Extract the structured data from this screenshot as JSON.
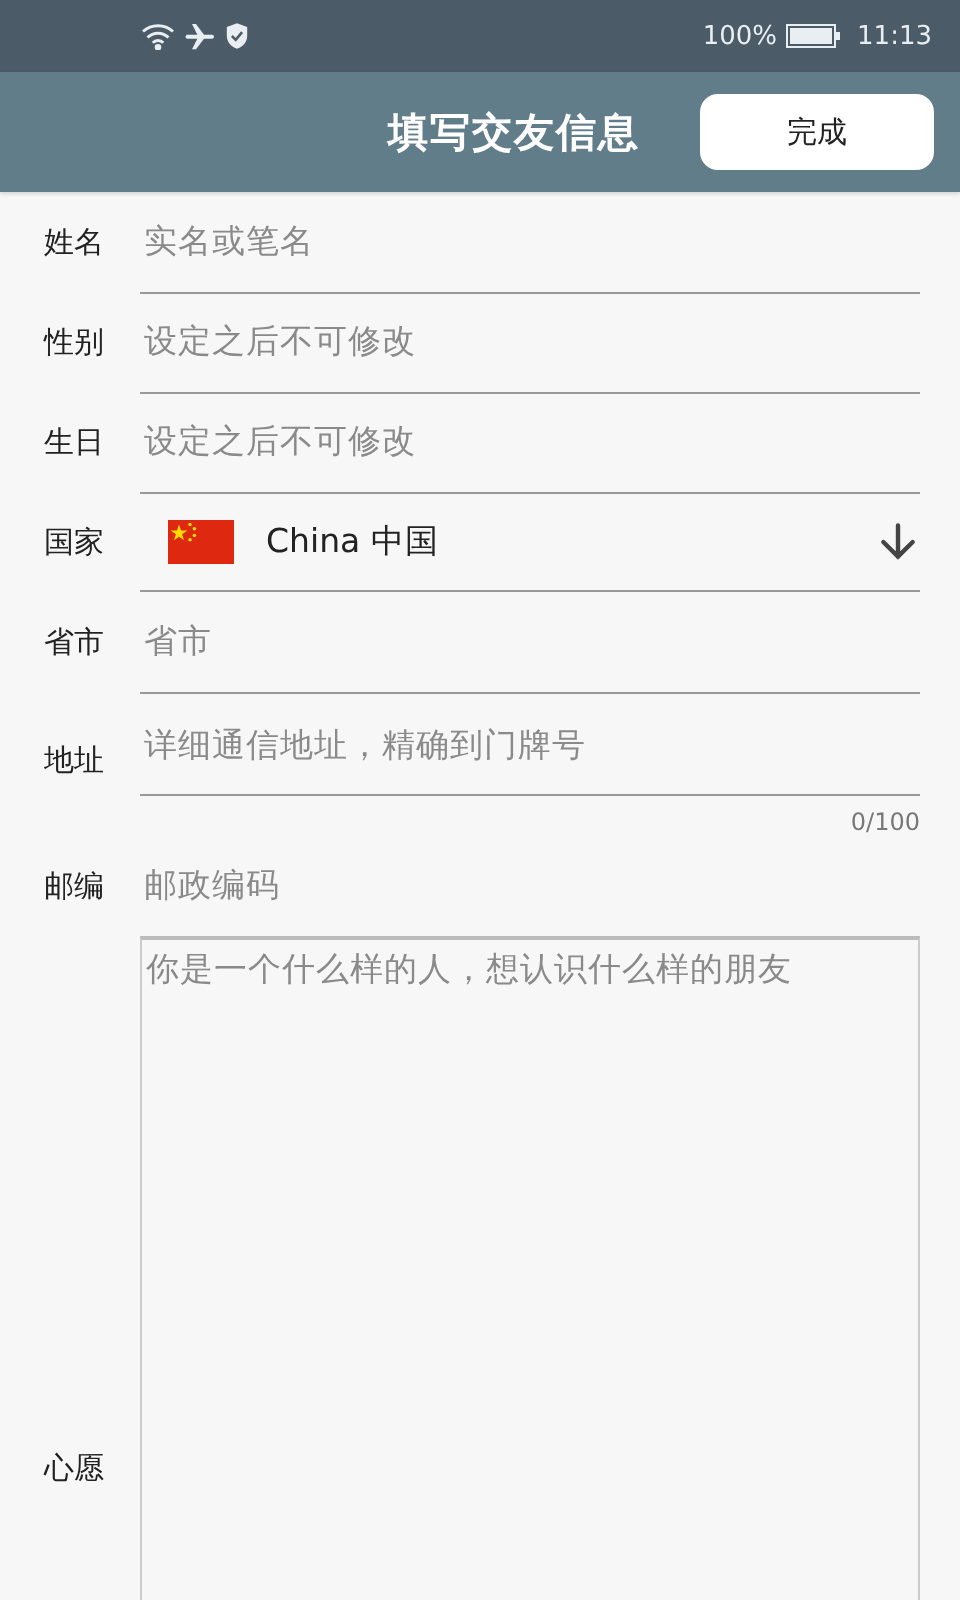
{
  "status_bar": {
    "battery_text": "100%",
    "time": "11:13"
  },
  "header": {
    "title": "填写交友信息",
    "done_button": "完成"
  },
  "fields": [
    {
      "kind": "text",
      "label": "姓名",
      "placeholder": "实名或笔名"
    },
    {
      "kind": "text",
      "label": "性别",
      "placeholder": "设定之后不可修改"
    },
    {
      "kind": "text",
      "label": "生日",
      "placeholder": "设定之后不可修改"
    },
    {
      "kind": "country",
      "label": "国家",
      "value": "China 中国"
    },
    {
      "kind": "text",
      "label": "省市",
      "placeholder": "省市"
    },
    {
      "kind": "text",
      "label": "地址",
      "placeholder": "详细通信地址，精确到门牌号",
      "counter": "0/100"
    },
    {
      "kind": "text",
      "label": "邮编",
      "placeholder": "邮政编码"
    },
    {
      "kind": "textarea",
      "label": "心愿",
      "placeholder": "你是一个什么样的人，想认识什么样的朋友"
    }
  ]
}
